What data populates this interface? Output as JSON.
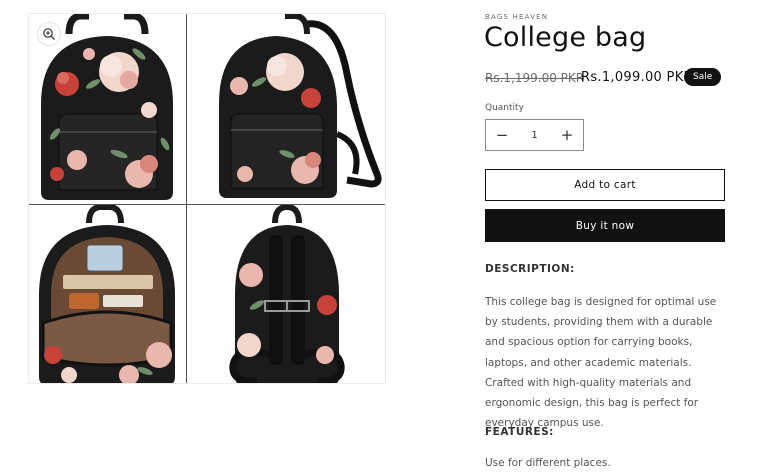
{
  "product": {
    "vendor": "BAGS HEAVEN",
    "title": "College bag",
    "price_regular": "Rs.1,199.00 PKR",
    "price_sale": "Rs.1,099.00 PKR",
    "badge": "Sale",
    "quantity_label": "Quantity",
    "quantity_value": "1",
    "decrease_symbol": "−",
    "increase_symbol": "+",
    "add_to_cart": "Add to cart",
    "buy_now": "Buy it now",
    "description_heading": "DESCRIPTION:",
    "description": "This college bag is designed for optimal use by students, providing them with a durable and spacious option for carrying books, laptops, and other academic materials. Crafted with high-quality materials and ergonomic design, this bag is perfect for everyday campus use.",
    "features_heading": "FEATURES:",
    "feature_1": "Use for different places."
  },
  "icons": {
    "zoom": "magnify-plus-icon"
  },
  "colors": {
    "text": "#121212",
    "muted": "#6b6b6b",
    "button_dark": "#121212",
    "bag_black": "#1b1b1b",
    "flower_pink": "#e9b7ad",
    "flower_red": "#c7433a",
    "leaf_green": "#6f8f6b"
  }
}
